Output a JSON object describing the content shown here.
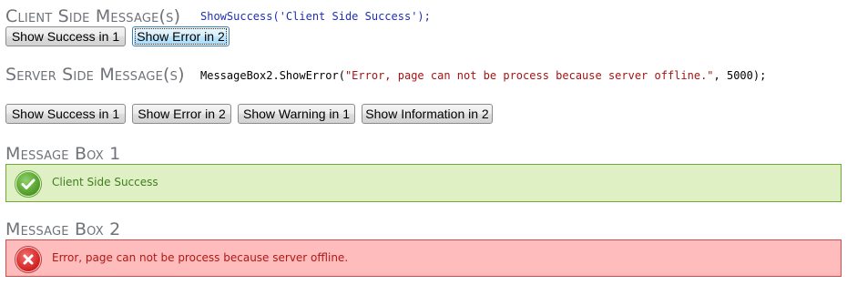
{
  "client": {
    "heading": "Client Side Message(s)",
    "code": "ShowSuccess('Client Side Success');",
    "buttons": [
      "Show Success in 1",
      "Show Error in 2"
    ]
  },
  "server": {
    "heading": "Server Side Message(s)",
    "code_prefix": "MessageBox2.ShowError(",
    "code_string": "\"Error, page can not be process because server offline.\"",
    "code_suffix": ", 5000);",
    "buttons": [
      "Show Success in 1",
      "Show Error in 2",
      "Show Warning in 1",
      "Show Information in 2"
    ]
  },
  "box1": {
    "heading": "Message Box 1",
    "message": "Client Side Success",
    "icon": "check-icon",
    "status": "success"
  },
  "box2": {
    "heading": "Message Box 2",
    "message": "Error, page can not be process because server offline.",
    "icon": "error-x-icon",
    "status": "error"
  },
  "colors": {
    "success_bg": "#dff0c4",
    "success_border": "#74a838",
    "error_bg": "#ffbcbc",
    "error_border": "#d24b4b",
    "heading": "#6f7378",
    "code_blue": "#1f2fb3",
    "code_string": "#a31515"
  }
}
